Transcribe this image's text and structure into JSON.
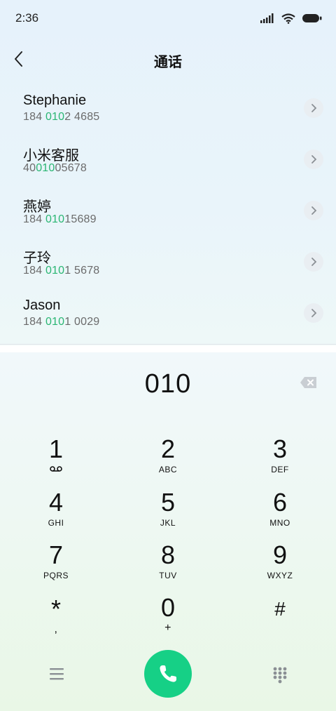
{
  "status_bar": {
    "time": "2:36"
  },
  "header": {
    "title": "通话"
  },
  "contacts": [
    {
      "name": "Stephanie",
      "pre": "184 ",
      "hl": "010",
      "post": "2 4685"
    },
    {
      "name": "小米客服",
      "pre": "40",
      "hl": "010",
      "post": "05678"
    },
    {
      "name": "燕婷",
      "pre": "184 ",
      "hl": "010",
      "post": "15689"
    },
    {
      "name": "子玲",
      "pre": "184 ",
      "hl": "010",
      "post": "1 5678"
    },
    {
      "name": "Jason",
      "pre": "184 ",
      "hl": "010",
      "post": "1 0029"
    }
  ],
  "dialer": {
    "input": "010",
    "keys": [
      {
        "digit": "1",
        "letters": ""
      },
      {
        "digit": "2",
        "letters": "ABC"
      },
      {
        "digit": "3",
        "letters": "DEF"
      },
      {
        "digit": "4",
        "letters": "GHI"
      },
      {
        "digit": "5",
        "letters": "JKL"
      },
      {
        "digit": "6",
        "letters": "MNO"
      },
      {
        "digit": "7",
        "letters": "PQRS"
      },
      {
        "digit": "8",
        "letters": "TUV"
      },
      {
        "digit": "9",
        "letters": "WXYZ"
      },
      {
        "digit": "*",
        "letters": ","
      },
      {
        "digit": "0",
        "letters": "+"
      },
      {
        "digit": "#",
        "letters": ""
      }
    ]
  },
  "colors": {
    "highlight": "#2bb673",
    "call_button": "#16d086"
  },
  "icons": {
    "back": "back-arrow-icon",
    "chevron": "chevron-right-icon",
    "backspace": "backspace-icon",
    "menu": "menu-icon",
    "call": "phone-icon",
    "dialpad": "dialpad-icon",
    "voicemail": "voicemail-icon"
  }
}
